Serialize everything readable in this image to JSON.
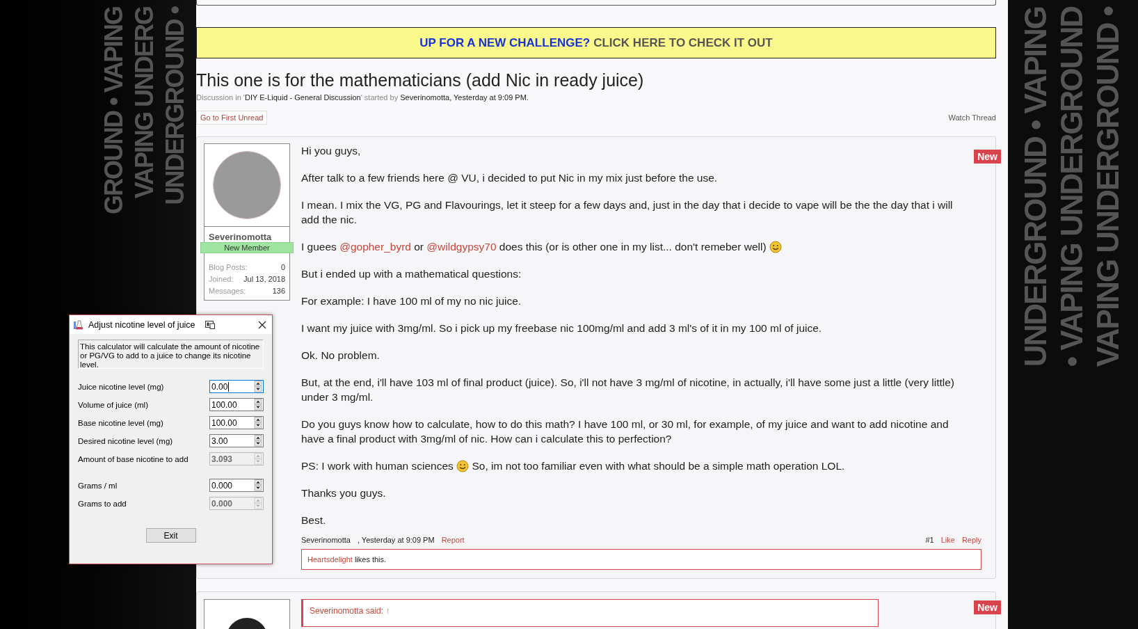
{
  "side_banners": {
    "left": [
      "GROUND • VAPING",
      "VAPING UNDERG",
      "UNDERGROUND •"
    ],
    "right": [
      "UNDERGROUND • VAPING",
      "• VAPING UNDERGROUND",
      "VAPING UNDERGROUND •"
    ]
  },
  "promo_banner": {
    "question": "UP FOR A NEW CHALLENGE?",
    "action": "CLICK HERE TO CHECK IT OUT"
  },
  "thread": {
    "title": "This one is for the mathematicians (add Nic in ready juice)",
    "meta_prefix": "Discussion in '",
    "forum": "DIY E-Liquid - General Discussion",
    "meta_middle": "' started by",
    "author": "Severinomotta",
    "meta_date": ", Yesterday at 9:09 PM.",
    "first_unread": "Go to First Unread",
    "watch": "Watch Thread"
  },
  "posts": [
    {
      "user": {
        "name": "Severinomotta",
        "rank": "New Member",
        "stats": [
          {
            "label": "Blog Posts:",
            "value": "0"
          },
          {
            "label": "Joined:",
            "value": "Jul 13, 2018"
          },
          {
            "label": "Messages:",
            "value": "136"
          }
        ]
      },
      "badge": "New",
      "paragraphs": [
        [
          {
            "kind": "text",
            "text": "Hi you guys,"
          }
        ],
        [
          {
            "kind": "text",
            "text": "After talk to a few friends here @ VU, i decided to put Nic in my mix just before the use."
          }
        ],
        [
          {
            "kind": "text",
            "text": "I mean. I mix the VG, PG and Flavourings, let it steep for a few days and, just in the day that i decide to vape will be the the day that i will add the nic."
          }
        ],
        [
          {
            "kind": "text",
            "text": "I guees "
          },
          {
            "kind": "mention",
            "text": "@gopher_byrd"
          },
          {
            "kind": "text",
            "text": " or "
          },
          {
            "kind": "mention",
            "text": "@wildgypsy70"
          },
          {
            "kind": "text",
            "text": " does this (or is other one in my list... don't remeber well) "
          },
          {
            "kind": "emoji"
          }
        ],
        [
          {
            "kind": "text",
            "text": "But i ended up with a mathematical questions:"
          }
        ],
        [
          {
            "kind": "text",
            "text": "For example: I have 100 ml of my no nic juice."
          }
        ],
        [
          {
            "kind": "text",
            "text": "I want my juice with 3mg/ml. So i pick up my freebase nic 100mg/ml and add 3 ml's of it in my 100 ml of juice."
          }
        ],
        [
          {
            "kind": "text",
            "text": "Ok. No problem."
          }
        ],
        [
          {
            "kind": "text",
            "text": "But, at the end, i'll have 103 ml of final product (juice). So, i'll not have 3 mg/ml of nicotine, in actually, i'll have some just a little (very little) under 3 mg/ml."
          }
        ],
        [
          {
            "kind": "text",
            "text": "Do you guys know how to calculate, how to do this math? I have 100 ml, or 30 ml, for example, of my juice and want to add nicotine and have a final product with 3mg/ml of nic. How can i calculate this to perfection?"
          }
        ],
        [
          {
            "kind": "text",
            "text": "PS: I work with human sciences "
          },
          {
            "kind": "emoji"
          },
          {
            "kind": "text",
            "text": " So, im not too familiar even with what should be a simple math operation LOL."
          }
        ],
        [
          {
            "kind": "text",
            "text": "Thanks you guys."
          }
        ],
        [
          {
            "kind": "text",
            "text": "Best."
          }
        ]
      ],
      "footer": {
        "author": "Severinomotta",
        "date": ", Yesterday at 9:09 PM",
        "report": "Report",
        "number": "#1",
        "like": "Like",
        "reply": "Reply"
      },
      "likes": {
        "user": "Heartsdelight",
        "text": " likes this."
      }
    },
    {
      "badge": "New",
      "quote": {
        "author": "Severinomotta said:",
        "arrow": "↑"
      }
    }
  ],
  "dialog": {
    "title": "Adjust nicotine level of juice",
    "description": "This calculator will calculate the amount of nicotine or PG/VG to add to a juice to change its nicotine level.",
    "fields": [
      {
        "label": "Juice nicotine level (mg)",
        "value": "0.00",
        "disabled": false,
        "focused": true
      },
      {
        "label": "Volume of juice (ml)",
        "value": "100.00",
        "disabled": false,
        "focused": false
      },
      {
        "label": "Base nicotine level (mg)",
        "value": "100.00",
        "disabled": false,
        "focused": false
      },
      {
        "label": "Desired nicotine level (mg)",
        "value": "3.00",
        "disabled": false,
        "focused": false
      },
      {
        "label": "Amount of base nicotine to add",
        "value": "3.093",
        "disabled": true,
        "focused": false
      }
    ],
    "weight_fields": [
      {
        "label": "Grams / ml",
        "value": "0.000",
        "disabled": false,
        "focused": false
      },
      {
        "label": "Grams to add",
        "value": "0.000",
        "disabled": true,
        "focused": false
      }
    ],
    "button": "Exit"
  }
}
